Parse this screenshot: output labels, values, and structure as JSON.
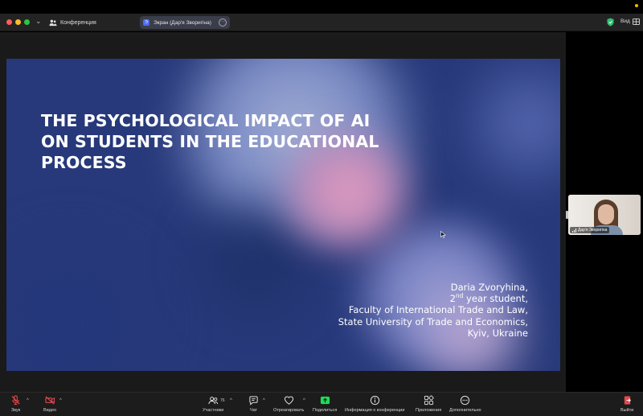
{
  "titlebar": {
    "conference_label": "Конференция",
    "share_label": "Экран (Дар'я Зворигіна)",
    "share_badge": "Э",
    "more_glyph": "···",
    "view_label": "Вид",
    "chevron": "⌄"
  },
  "slide": {
    "title_lines": [
      "THE PSYCHOLOGICAL IMPACT OF AI",
      "ON STUDENTS IN THE EDUCATIONAL",
      "PROCESS"
    ],
    "author_name": "Daria Zvoryhina,",
    "year_number": "2",
    "year_suffix": "nd",
    "year_text": " year student,",
    "faculty": "Faculty of International Trade and Law,",
    "university": "State University of Trade and Economics,",
    "city": "Kyiv, Ukraine"
  },
  "participant": {
    "name": "Дар'я Зворигіна"
  },
  "toolbar": {
    "audio_label": "Звук",
    "video_label": "Видео",
    "participants_label": "Участники",
    "participants_count": "76",
    "chat_label": "Чат",
    "react_label": "Отреагировать",
    "share_label": "Поделиться",
    "info_label": "Информация о конференции",
    "apps_label": "Приложения",
    "more_label": "Дополнительно",
    "leave_label": "Выйти",
    "caret": "^"
  },
  "colors": {
    "share_green": "#23d959",
    "mute_red": "#e5484d",
    "leave_red": "#e5484d",
    "shield_green": "#2fbf71"
  }
}
